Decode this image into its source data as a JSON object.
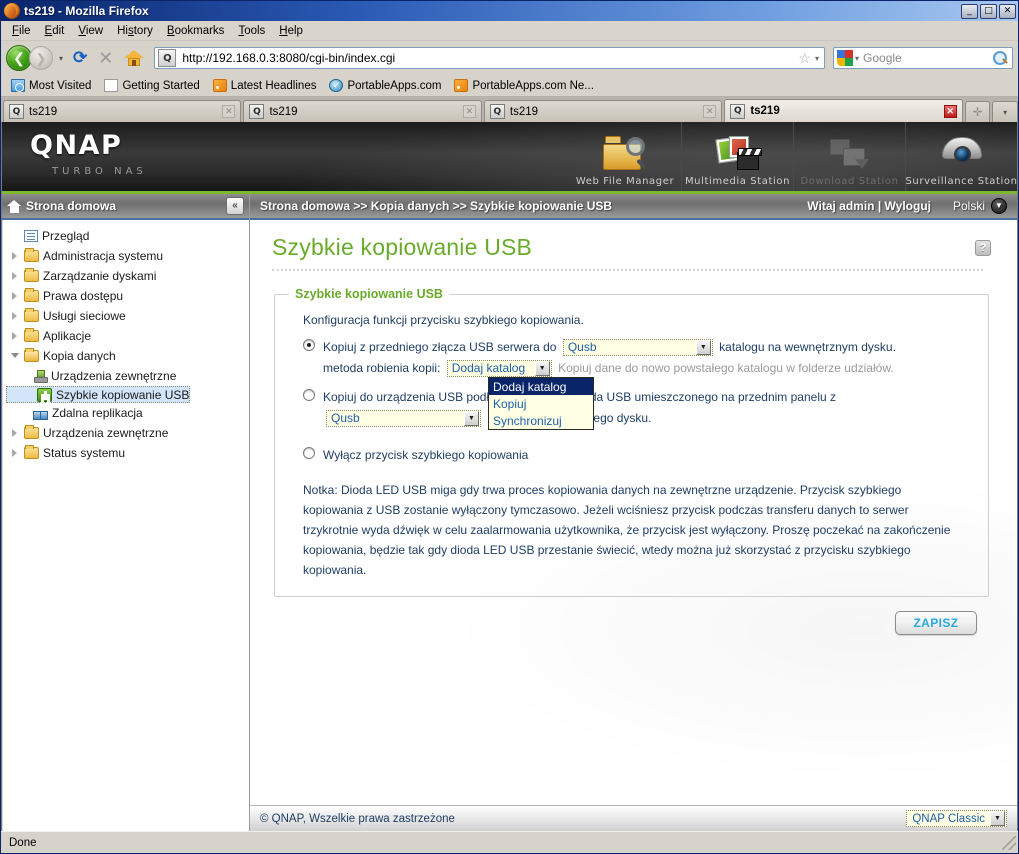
{
  "window": {
    "title": "ts219 - Mozilla Firefox",
    "minimize": "_",
    "maximize": "□",
    "close": "✕"
  },
  "menubar": {
    "items": [
      "File",
      "Edit",
      "View",
      "History",
      "Bookmarks",
      "Tools",
      "Help"
    ]
  },
  "toolbar": {
    "back_glyph": "❮",
    "forward_glyph": "❯",
    "dropdown_glyph": "▾",
    "reload_glyph": "⟳",
    "stop_glyph": "✕",
    "url": "http://192.168.0.3:8080/cgi-bin/index.cgi",
    "favicon_letter": "Q",
    "star_glyph": "☆",
    "search_placeholder": "Google"
  },
  "bookmarks": [
    {
      "label": "Most Visited",
      "icon": "folder-icon"
    },
    {
      "label": "Getting Started",
      "icon": "page-icon"
    },
    {
      "label": "Latest Headlines",
      "icon": "feed-icon"
    },
    {
      "label": "PortableApps.com",
      "icon": "check-circle-icon"
    },
    {
      "label": "PortableApps.com Ne...",
      "icon": "feed-icon"
    }
  ],
  "tabs": [
    {
      "label": "ts219",
      "active": false
    },
    {
      "label": "ts219",
      "active": false
    },
    {
      "label": "ts219",
      "active": false
    },
    {
      "label": "ts219",
      "active": true
    }
  ],
  "tabstrip": {
    "new_tab_glyph": "✛",
    "list_glyph": "▾",
    "close_glyph": "✕"
  },
  "qnap_header": {
    "logo": "QNAP",
    "logo_sub": "TURBO NAS",
    "stations": [
      {
        "label": "Web File Manager",
        "icon": "folder-search-icon",
        "dim": false
      },
      {
        "label": "Multimedia Station",
        "icon": "media-icon",
        "dim": false
      },
      {
        "label": "Download Station",
        "icon": "download-icon",
        "dim": true
      },
      {
        "label": "Surveillance Station",
        "icon": "camera-icon",
        "dim": false
      }
    ]
  },
  "sidebar": {
    "header": "Strona domowa",
    "collapse_glyph": "«",
    "items": [
      {
        "label": "Przegląd",
        "icon": "document-icon",
        "level": 1,
        "arrow": "none",
        "selected": false
      },
      {
        "label": "Administracja systemu",
        "icon": "folder-icon",
        "level": 1,
        "arrow": "closed",
        "selected": false
      },
      {
        "label": "Zarządzanie dyskami",
        "icon": "folder-icon",
        "level": 1,
        "arrow": "closed",
        "selected": false
      },
      {
        "label": "Prawa dostępu",
        "icon": "folder-icon",
        "level": 1,
        "arrow": "closed",
        "selected": false
      },
      {
        "label": "Usługi sieciowe",
        "icon": "folder-icon",
        "level": 1,
        "arrow": "closed",
        "selected": false
      },
      {
        "label": "Aplikacje",
        "icon": "folder-icon",
        "level": 1,
        "arrow": "closed",
        "selected": false
      },
      {
        "label": "Kopia danych",
        "icon": "folder-open-icon",
        "level": 1,
        "arrow": "open",
        "selected": false
      },
      {
        "label": "Urządzenia zewnętrzne",
        "icon": "external-device-icon",
        "level": 2,
        "arrow": "none",
        "selected": false
      },
      {
        "label": "Szybkie kopiowanie USB",
        "icon": "usb-icon",
        "level": 2,
        "arrow": "none",
        "selected": true
      },
      {
        "label": "Zdalna replikacja",
        "icon": "replication-icon",
        "level": 2,
        "arrow": "none",
        "selected": false
      },
      {
        "label": "Urządzenia zewnętrzne",
        "icon": "folder-icon",
        "level": 1,
        "arrow": "closed",
        "selected": false
      },
      {
        "label": "Status systemu",
        "icon": "folder-icon",
        "level": 1,
        "arrow": "closed",
        "selected": false
      }
    ]
  },
  "breadcrumb": {
    "path": "Strona domowa >> Kopia danych >> Szybkie kopiowanie USB",
    "user": "Witaj admin | Wyloguj",
    "language": "Polski",
    "lang_caret": "▼"
  },
  "main": {
    "page_title": "Szybkie kopiowanie USB",
    "help_glyph": "?",
    "panel_legend": "Szybkie kopiowanie USB",
    "intro": "Konfiguracja funkcji przycisku szybkiego kopiowania.",
    "option1": {
      "selected": true,
      "text_before": "Kopiuj z przedniego złącza USB serwera do",
      "share_value": "Qusb",
      "text_after": "katalogu na wewnętrznym dysku.",
      "method_label": "metoda robienia kopii:",
      "method_value": "Dodaj katalog",
      "method_hint": "Kopiuj dane do nowo powstałego katalogu w folderze udziałów.",
      "dropdown_open": true,
      "dropdown_options": [
        "Dodaj katalog",
        "Kopiuj",
        "Synchronizuj"
      ],
      "dropdown_selected_index": 0
    },
    "option2": {
      "selected": false,
      "text_before": "Kopiuj do urządzenia USB podłączonego do gniazda USB umieszczonego na przednim panelu z",
      "share_value": "Qusb",
      "text_after": "katalogu wewnętrznego dysku."
    },
    "option3": {
      "selected": false,
      "text": "Wyłącz przycisk szybkiego kopiowania"
    },
    "note": "Notka: Dioda LED USB miga gdy trwa proces kopiowania danych na zewnętrzne urządzenie. Przycisk szybkiego kopiowania z USB zostanie wyłączony tymczasowo. Jeżeli wciśniesz przycisk podczas transferu danych to serwer trzykrotnie wyda dźwięk w celu zaalarmowania użytkownika, że przycisk jest wyłączony. Proszę poczekać na zakończenie kopiowania, będzie tak gdy dioda LED USB przestanie świecić, wtedy można już skorzystać z przycisku szybkiego kopiowania.",
    "save_button": "ZAPISZ",
    "dropdown_caret": "▼"
  },
  "qnap_footer": {
    "copyright": "© QNAP, Wszelkie prawa zastrzeżone",
    "theme_value": "QNAP Classic",
    "theme_caret": "▼"
  },
  "statusbar": {
    "text": "Done"
  },
  "colors": {
    "accent_green": "#7cb82f",
    "title_green": "#6aab2b",
    "link_blue": "#1f5fa9",
    "text_navy": "#1f3e63",
    "dropdown_highlight": "#0a246a",
    "select_bg": "#FFFFE4",
    "selected_row": "#d3e5f9",
    "save_label": "#29a8e0"
  }
}
